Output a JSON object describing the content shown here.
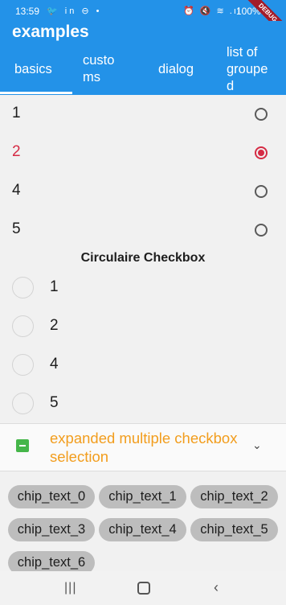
{
  "status_bar": {
    "time": "13:59",
    "left_icons": [
      "twitter-icon",
      "linkedin-icon",
      "dnd-icon",
      "dot-icon"
    ],
    "left_glyphs": "🐦 in ⊖ •",
    "right_glyphs": "⏰ 🔇 ≋ .ıl",
    "battery": "100%",
    "debug_label": "DEBUG"
  },
  "app_bar": {
    "title": "examples",
    "tabs": [
      {
        "label": "basics",
        "selected": true
      },
      {
        "label": "custo\nms"
      },
      {
        "label": "dialog"
      },
      {
        "label": "list of\ngroupe\nd"
      }
    ]
  },
  "radio_list": [
    {
      "label": "1",
      "selected": false
    },
    {
      "label": "2",
      "selected": true
    },
    {
      "label": "4",
      "selected": false
    },
    {
      "label": "5",
      "selected": false
    }
  ],
  "circular_section": {
    "title": "Circulaire Checkbox",
    "items": [
      {
        "label": "1"
      },
      {
        "label": "2"
      },
      {
        "label": "4"
      },
      {
        "label": "5"
      }
    ]
  },
  "expansion": {
    "label": "expanded multiple checkbox selection",
    "chevron_icon": "chevron-down-icon",
    "chevron_glyph": "⌄"
  },
  "chips": [
    "chip_text_0",
    "chip_text_1",
    "chip_text_2",
    "chip_text_3",
    "chip_text_4",
    "chip_text_5",
    "chip_text_6"
  ],
  "nav_bar": {
    "recent_glyph": "|||",
    "back_glyph": "‹"
  },
  "colors": {
    "primary": "#2392e8",
    "selected": "#d52b44",
    "orange": "#f29d1d",
    "green": "#45b649"
  }
}
